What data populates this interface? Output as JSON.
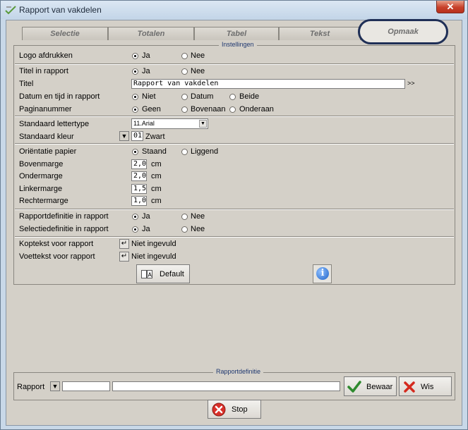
{
  "window": {
    "title": "Rapport van vakdelen",
    "close": "✕"
  },
  "tabs": [
    {
      "label": "Selectie"
    },
    {
      "label": "Totalen"
    },
    {
      "label": "Tabel"
    },
    {
      "label": "Tekst"
    },
    {
      "label": "Opmaak",
      "active": true
    }
  ],
  "settings": {
    "legend": "Instellingen",
    "logo": {
      "label": "Logo afdrukken",
      "options": [
        "Ja",
        "Nee"
      ],
      "selected": "Ja"
    },
    "title_in_report": {
      "label": "Titel in rapport",
      "options": [
        "Ja",
        "Nee"
      ],
      "selected": "Ja"
    },
    "title": {
      "label": "Titel",
      "value": "Rapport van vakdelen",
      "more": ">>"
    },
    "datetime": {
      "label": "Datum en tijd in rapport",
      "options": [
        "Niet",
        "Datum",
        "Beide"
      ],
      "selected": "Niet"
    },
    "page_number": {
      "label": "Paginanummer",
      "options": [
        "Geen",
        "Bovenaan",
        "Onderaan"
      ],
      "selected": "Geen"
    },
    "font": {
      "label": "Standaard lettertype",
      "value": "11.Arial"
    },
    "color": {
      "label": "Standaard kleur",
      "code": "01",
      "name": "Zwart"
    },
    "orientation": {
      "label": "Oriëntatie papier",
      "options": [
        "Staand",
        "Liggend"
      ],
      "selected": "Staand"
    },
    "margins": {
      "unit": "cm",
      "top": {
        "label": "Bovenmarge",
        "value": "2,0"
      },
      "bottom": {
        "label": "Ondermarge",
        "value": "2,0"
      },
      "left": {
        "label": "Linkermarge",
        "value": "1,5"
      },
      "right": {
        "label": "Rechtermarge",
        "value": "1,0"
      }
    },
    "report_def": {
      "label": "Rapportdefinitie in rapport",
      "options": [
        "Ja",
        "Nee"
      ],
      "selected": "Ja"
    },
    "selection_def": {
      "label": "Selectiedefinitie in rapport",
      "options": [
        "Ja",
        "Nee"
      ],
      "selected": "Ja"
    },
    "header": {
      "label": "Koptekst voor rapport",
      "value": "Niet ingevuld"
    },
    "footer": {
      "label": "Voettekst voor rapport",
      "value": "Niet ingevuld"
    },
    "default_button": "Default"
  },
  "report_definition": {
    "legend": "Rapportdefinitie",
    "label": "Rapport",
    "code_value": "",
    "name_value": "",
    "save_button": "Bewaar",
    "clear_button": "Wis"
  },
  "stop_button": "Stop"
}
